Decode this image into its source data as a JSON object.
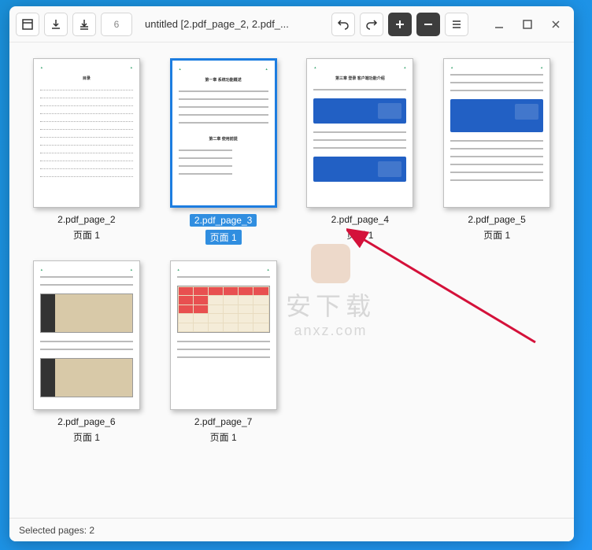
{
  "titlebar": {
    "page_count": "6",
    "title": "untitled [2.pdf_page_2, 2.pdf_..."
  },
  "icons": {
    "layout": "layout-icon",
    "download": "download-icon",
    "download2": "download-all-icon",
    "rotate_left": "rotate-left-icon",
    "rotate_right": "rotate-right-icon",
    "add": "add-icon",
    "remove": "remove-icon",
    "menu": "menu-icon",
    "minimize": "minimize-icon",
    "maximize": "maximize-icon",
    "close": "close-icon"
  },
  "thumbnails": [
    {
      "name": "2.pdf_page_2",
      "page": "页面 1",
      "kind": "toc",
      "selected": false
    },
    {
      "name": "2.pdf_page_3",
      "page": "页面 1",
      "kind": "text",
      "selected": true
    },
    {
      "name": "2.pdf_page_4",
      "page": "页面 1",
      "kind": "login",
      "selected": false
    },
    {
      "name": "2.pdf_page_5",
      "page": "页面 1",
      "kind": "login2",
      "selected": false
    },
    {
      "name": "2.pdf_page_6",
      "page": "页面 1",
      "kind": "img",
      "selected": false
    },
    {
      "name": "2.pdf_page_7",
      "page": "页面 1",
      "kind": "cal",
      "selected": false
    }
  ],
  "status": {
    "selected": "Selected pages: 2"
  },
  "watermark": {
    "cn": "安下载",
    "en": "anxz.com"
  }
}
